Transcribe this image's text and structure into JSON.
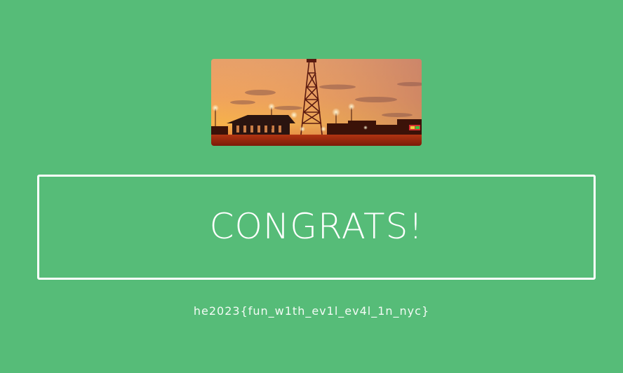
{
  "page": {
    "background": "#56bc78",
    "banner_image": "coney-island-parachute-jump-sunset-photo"
  },
  "message": {
    "title": "CONGRATS!"
  },
  "flag": {
    "text": "he2023{fun_w1th_ev1l_ev4l_1n_nyc}"
  }
}
